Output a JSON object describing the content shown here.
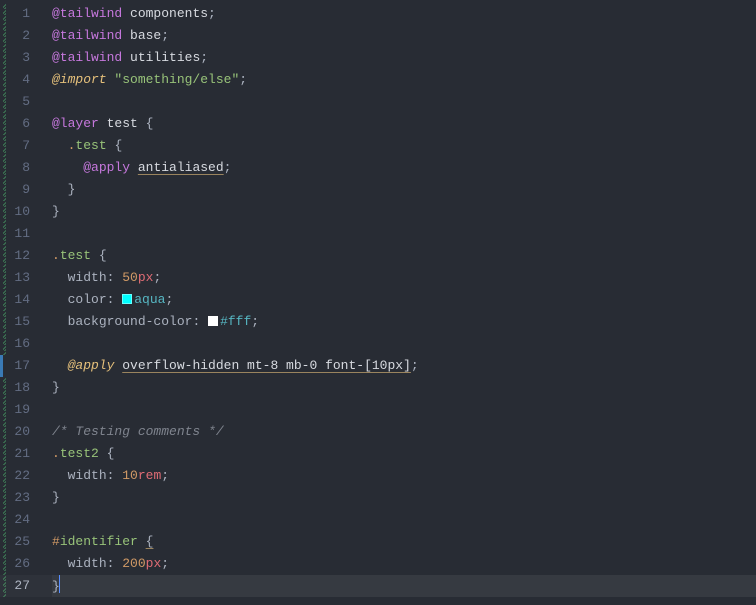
{
  "editor": {
    "language": "css",
    "active_line": 27,
    "lines": [
      {
        "n": 1,
        "diff": "untracked",
        "tokens": [
          [
            "kw",
            "@tailwind"
          ],
          [
            "sp",
            " "
          ],
          [
            "white",
            "components"
          ],
          [
            "punct",
            ";"
          ]
        ]
      },
      {
        "n": 2,
        "diff": "untracked",
        "tokens": [
          [
            "kw",
            "@tailwind"
          ],
          [
            "sp",
            " "
          ],
          [
            "white",
            "base"
          ],
          [
            "punct",
            ";"
          ]
        ]
      },
      {
        "n": 3,
        "diff": "untracked",
        "tokens": [
          [
            "kw",
            "@tailwind"
          ],
          [
            "sp",
            " "
          ],
          [
            "white",
            "utilities"
          ],
          [
            "punct",
            ";"
          ]
        ]
      },
      {
        "n": 4,
        "diff": "untracked",
        "tokens": [
          [
            "kw-imp",
            "@import"
          ],
          [
            "sp",
            " "
          ],
          [
            "str",
            "\"something/else\""
          ],
          [
            "punct",
            ";"
          ]
        ]
      },
      {
        "n": 5,
        "diff": "untracked",
        "tokens": []
      },
      {
        "n": 6,
        "diff": "untracked",
        "tokens": [
          [
            "kw",
            "@layer"
          ],
          [
            "sp",
            " "
          ],
          [
            "white",
            "test"
          ],
          [
            "sp",
            " "
          ],
          [
            "brace",
            "{"
          ]
        ]
      },
      {
        "n": 7,
        "diff": "untracked",
        "tokens": [
          [
            "sp",
            "  "
          ],
          [
            "sel-dot",
            "."
          ],
          [
            "sel-name",
            "test"
          ],
          [
            "sp",
            " "
          ],
          [
            "brace",
            "{"
          ]
        ]
      },
      {
        "n": 8,
        "diff": "untracked",
        "tokens": [
          [
            "sp",
            "    "
          ],
          [
            "kw",
            "@apply"
          ],
          [
            "sp",
            " "
          ],
          [
            "white-ul",
            "antialiased"
          ],
          [
            "punct",
            ";"
          ]
        ]
      },
      {
        "n": 9,
        "diff": "untracked",
        "tokens": [
          [
            "sp",
            "  "
          ],
          [
            "brace",
            "}"
          ]
        ]
      },
      {
        "n": 10,
        "diff": "untracked",
        "tokens": [
          [
            "brace",
            "}"
          ]
        ]
      },
      {
        "n": 11,
        "diff": "untracked",
        "tokens": []
      },
      {
        "n": 12,
        "diff": "untracked",
        "tokens": [
          [
            "sel-dot",
            "."
          ],
          [
            "sel-name",
            "test"
          ],
          [
            "sp",
            " "
          ],
          [
            "brace",
            "{"
          ]
        ]
      },
      {
        "n": 13,
        "diff": "untracked",
        "tokens": [
          [
            "sp",
            "  "
          ],
          [
            "prop",
            "width"
          ],
          [
            "punct",
            ":"
          ],
          [
            "sp",
            " "
          ],
          [
            "num",
            "50"
          ],
          [
            "unit",
            "px"
          ],
          [
            "punct",
            ";"
          ]
        ]
      },
      {
        "n": 14,
        "diff": "untracked",
        "tokens": [
          [
            "sp",
            "  "
          ],
          [
            "prop",
            "color"
          ],
          [
            "punct",
            ":"
          ],
          [
            "sp",
            " "
          ],
          [
            "swatch",
            "#00ffff"
          ],
          [
            "const",
            "aqua"
          ],
          [
            "punct",
            ";"
          ]
        ]
      },
      {
        "n": 15,
        "diff": "untracked",
        "tokens": [
          [
            "sp",
            "  "
          ],
          [
            "prop",
            "background-color"
          ],
          [
            "punct",
            ":"
          ],
          [
            "sp",
            " "
          ],
          [
            "swatch",
            "#ffffff"
          ],
          [
            "hex",
            "#fff"
          ],
          [
            "punct",
            ";"
          ]
        ]
      },
      {
        "n": 16,
        "diff": "untracked",
        "tokens": []
      },
      {
        "n": 17,
        "diff": "mod",
        "tokens": [
          [
            "sp",
            "  "
          ],
          [
            "kw-imp",
            "@apply"
          ],
          [
            "sp",
            " "
          ],
          [
            "white-ul",
            "overflow-hidden mt-8 mb-0 font-[10px]"
          ],
          [
            "punct",
            ";"
          ]
        ]
      },
      {
        "n": 18,
        "diff": "untracked",
        "tokens": [
          [
            "brace",
            "}"
          ]
        ]
      },
      {
        "n": 19,
        "diff": "untracked",
        "tokens": []
      },
      {
        "n": 20,
        "diff": "untracked",
        "tokens": [
          [
            "comment",
            "/* Testing comments */"
          ]
        ]
      },
      {
        "n": 21,
        "diff": "untracked",
        "tokens": [
          [
            "sel-dot",
            "."
          ],
          [
            "sel-name",
            "test2"
          ],
          [
            "sp",
            " "
          ],
          [
            "brace",
            "{"
          ]
        ]
      },
      {
        "n": 22,
        "diff": "untracked",
        "tokens": [
          [
            "sp",
            "  "
          ],
          [
            "prop",
            "width"
          ],
          [
            "punct",
            ":"
          ],
          [
            "sp",
            " "
          ],
          [
            "num",
            "10"
          ],
          [
            "unit",
            "rem"
          ],
          [
            "punct",
            ";"
          ]
        ]
      },
      {
        "n": 23,
        "diff": "untracked",
        "tokens": [
          [
            "brace",
            "}"
          ]
        ]
      },
      {
        "n": 24,
        "diff": "untracked",
        "tokens": []
      },
      {
        "n": 25,
        "diff": "untracked",
        "tokens": [
          [
            "sel-dot",
            "#"
          ],
          [
            "sel-name",
            "identifier"
          ],
          [
            "sp",
            " "
          ],
          [
            "brace-ul",
            "{"
          ]
        ]
      },
      {
        "n": 26,
        "diff": "untracked",
        "tokens": [
          [
            "sp",
            "  "
          ],
          [
            "prop",
            "width"
          ],
          [
            "punct",
            ":"
          ],
          [
            "sp",
            " "
          ],
          [
            "num",
            "200"
          ],
          [
            "unit",
            "px"
          ],
          [
            "punct",
            ";"
          ]
        ]
      },
      {
        "n": 27,
        "diff": "untracked",
        "active": true,
        "tokens": [
          [
            "brace",
            "}"
          ],
          [
            "cursor",
            ""
          ]
        ]
      }
    ]
  },
  "colors": {
    "bg": "#282c34",
    "keyword": "#c678dd",
    "keyword_import": "#e5c07b",
    "string": "#98c379",
    "selector_punct": "#d19a66",
    "number": "#d19a66",
    "unit": "#e06c75",
    "constant": "#56b6c2",
    "comment": "#7f848e",
    "text": "#abb2bf"
  }
}
